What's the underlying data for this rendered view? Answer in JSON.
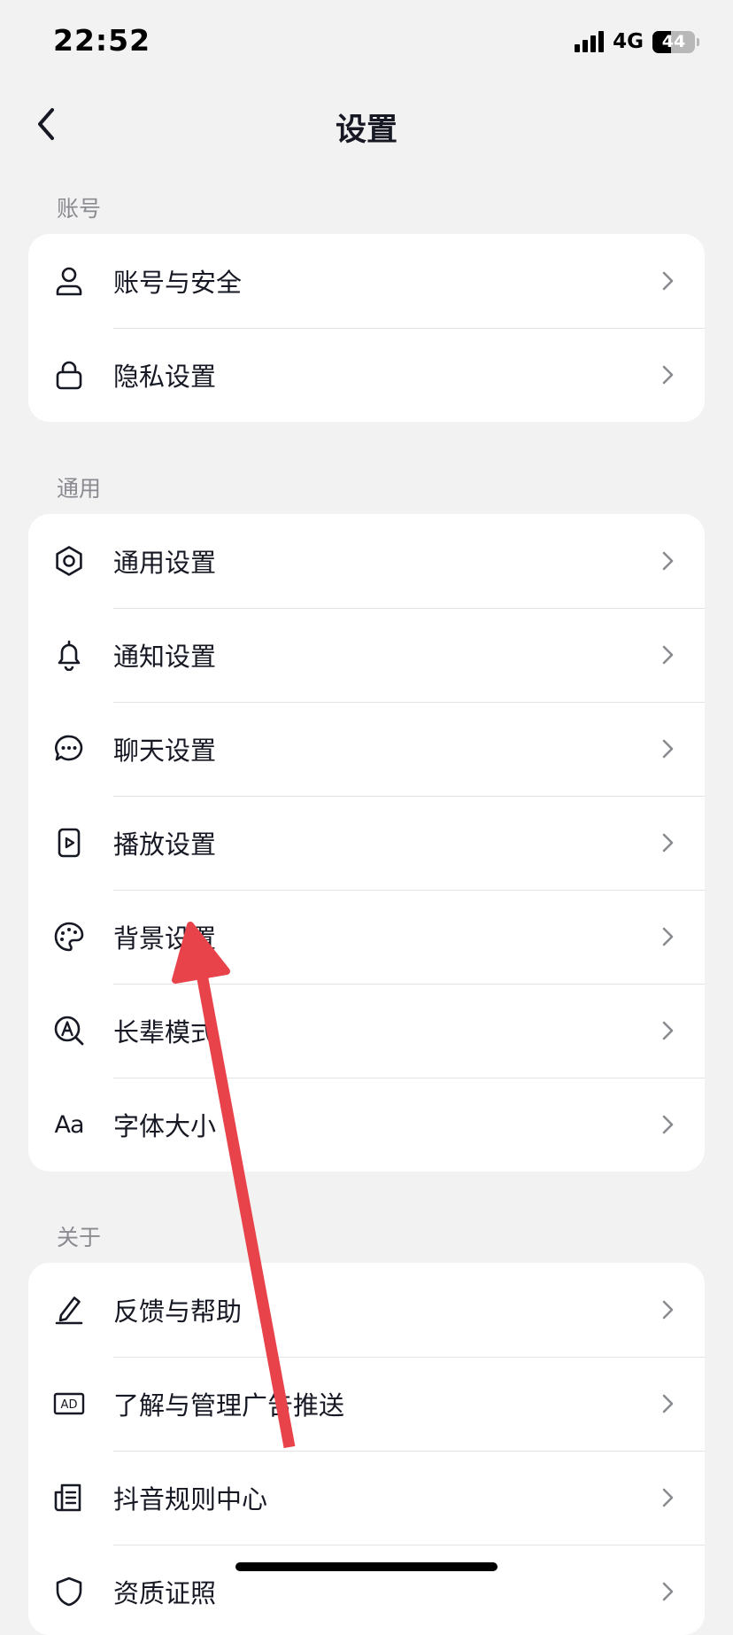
{
  "status_bar": {
    "time": "22:52",
    "network": "4G",
    "battery": "44",
    "battery_level": 0.44
  },
  "header": {
    "title": "设置",
    "back_icon": "chevron-left-icon"
  },
  "sections": [
    {
      "header": "账号",
      "items": [
        {
          "label": "账号与安全",
          "icon": "user-icon"
        },
        {
          "label": "隐私设置",
          "icon": "lock-icon"
        }
      ]
    },
    {
      "header": "通用",
      "items": [
        {
          "label": "通用设置",
          "icon": "gear-icon"
        },
        {
          "label": "通知设置",
          "icon": "bell-icon"
        },
        {
          "label": "聊天设置",
          "icon": "chat-bubble-icon"
        },
        {
          "label": "播放设置",
          "icon": "play-icon"
        },
        {
          "label": "背景设置",
          "icon": "palette-icon"
        },
        {
          "label": "长辈模式",
          "icon": "elder-mode-icon"
        },
        {
          "label": "字体大小",
          "icon": "font-size-icon",
          "icon_text": "Aa"
        }
      ]
    },
    {
      "header": "关于",
      "items": [
        {
          "label": "反馈与帮助",
          "icon": "pencil-icon"
        },
        {
          "label": "了解与管理广告推送",
          "icon": "ad-icon",
          "icon_text": "AD"
        },
        {
          "label": "抖音规则中心",
          "icon": "document-icon"
        },
        {
          "label": "资质证照",
          "icon": "shield-icon"
        }
      ]
    }
  ],
  "colors": {
    "background": "#f2f2f2",
    "card": "#ffffff",
    "text": "#161823",
    "section_header": "#8a8b91",
    "annotation_arrow": "#e8434b"
  }
}
